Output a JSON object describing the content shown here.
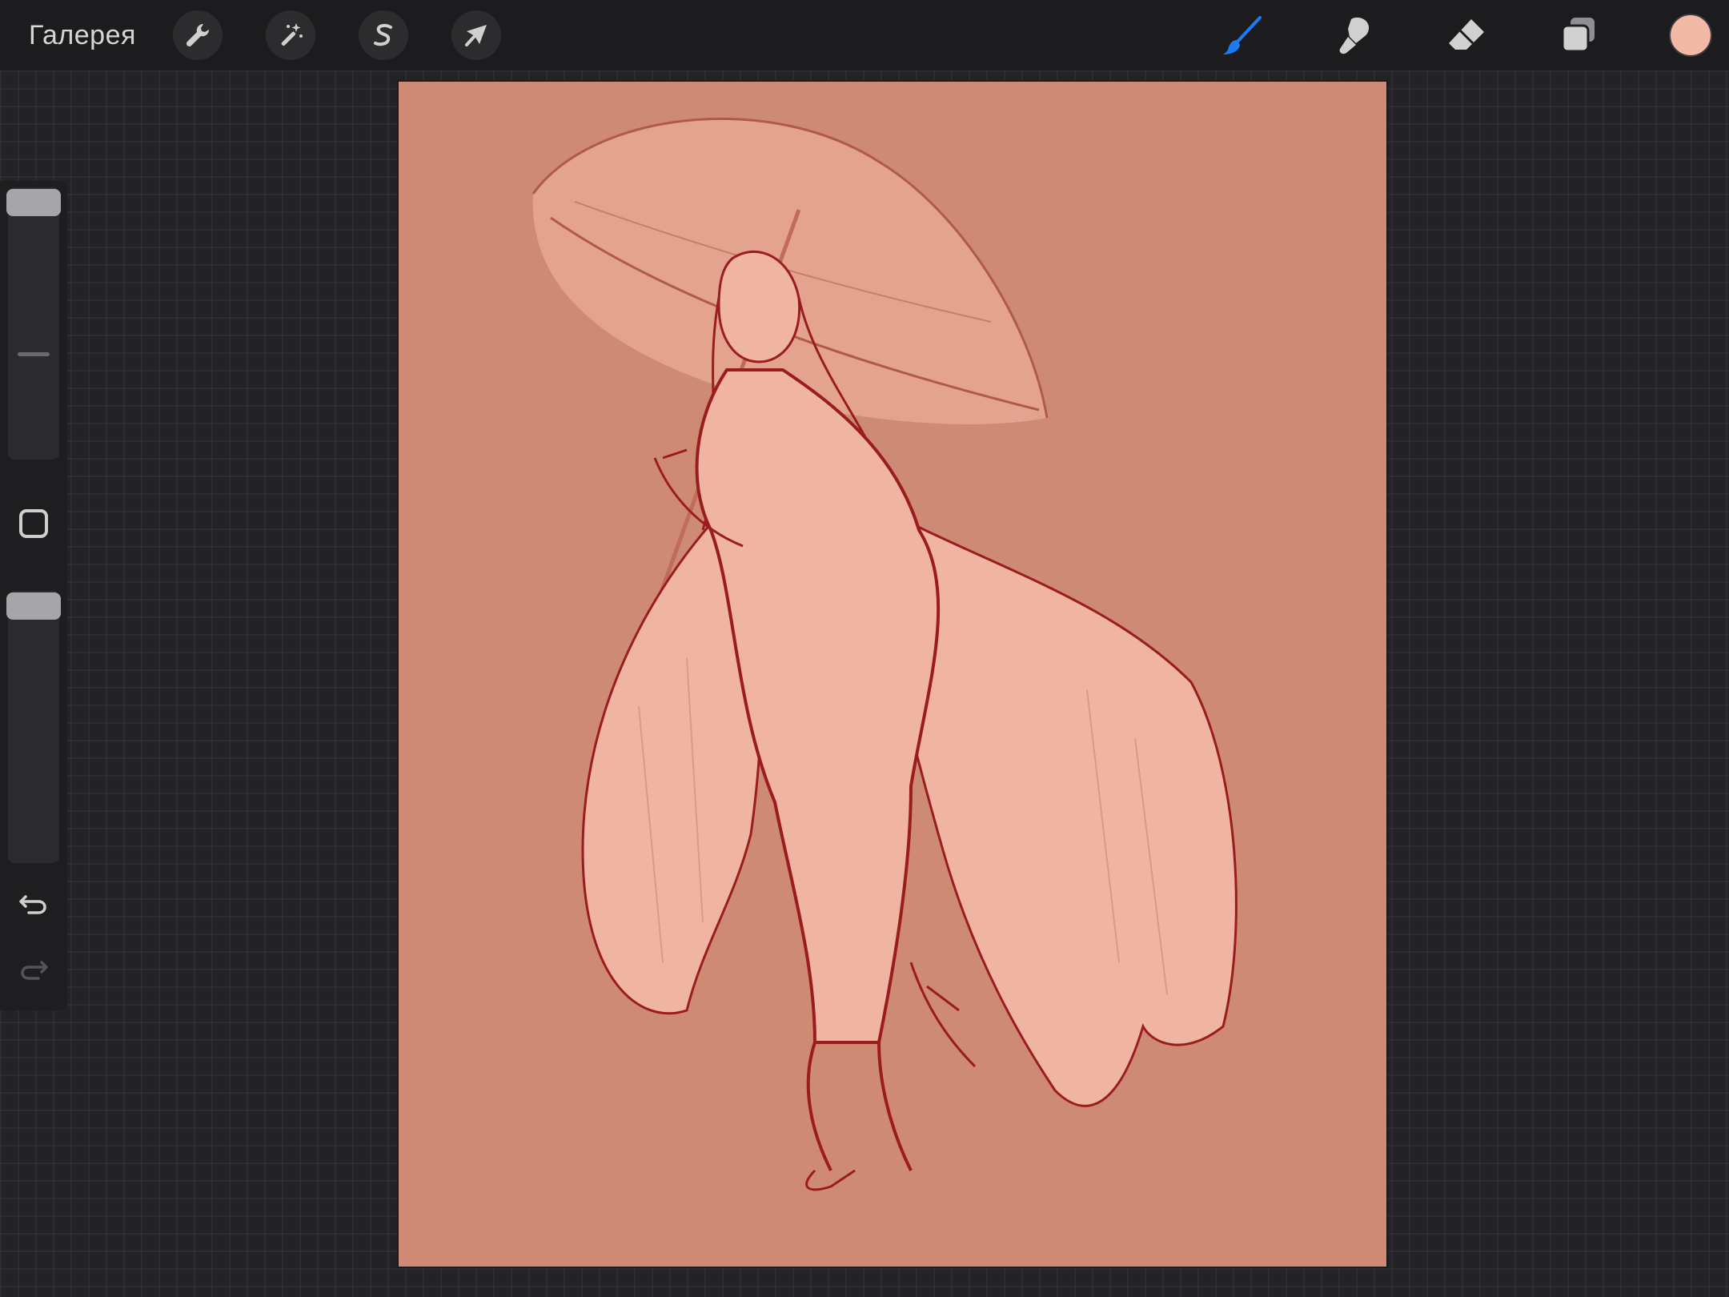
{
  "topbar": {
    "gallery_label": "Галерея",
    "left_tools": [
      {
        "name": "actions",
        "icon": "wrench-icon"
      },
      {
        "name": "adjustments",
        "icon": "magic-wand-icon"
      },
      {
        "name": "selection",
        "icon": "selection-s-icon"
      },
      {
        "name": "transform",
        "icon": "arrow-cursor-icon"
      }
    ],
    "right_tools": [
      {
        "name": "brush",
        "icon": "brush-icon",
        "active": true
      },
      {
        "name": "smudge",
        "icon": "smudge-icon"
      },
      {
        "name": "eraser",
        "icon": "eraser-icon"
      },
      {
        "name": "layers",
        "icon": "layers-icon"
      }
    ],
    "current_color": "#f2b9a6",
    "active_color": "#1a7cf5"
  },
  "sidebar": {
    "brush_size_icon": "slider-thumb",
    "opacity_icon": "slider-thumb",
    "modify_button_icon": "square-icon",
    "undo_icon": "undo-arrow-icon",
    "redo_icon": "redo-arrow-icon"
  },
  "canvas": {
    "background_color": "#cf8a76",
    "fill_color": "#efb4a2",
    "line_color": "#9b1c1c",
    "sketch_color": "#b05a4c"
  }
}
